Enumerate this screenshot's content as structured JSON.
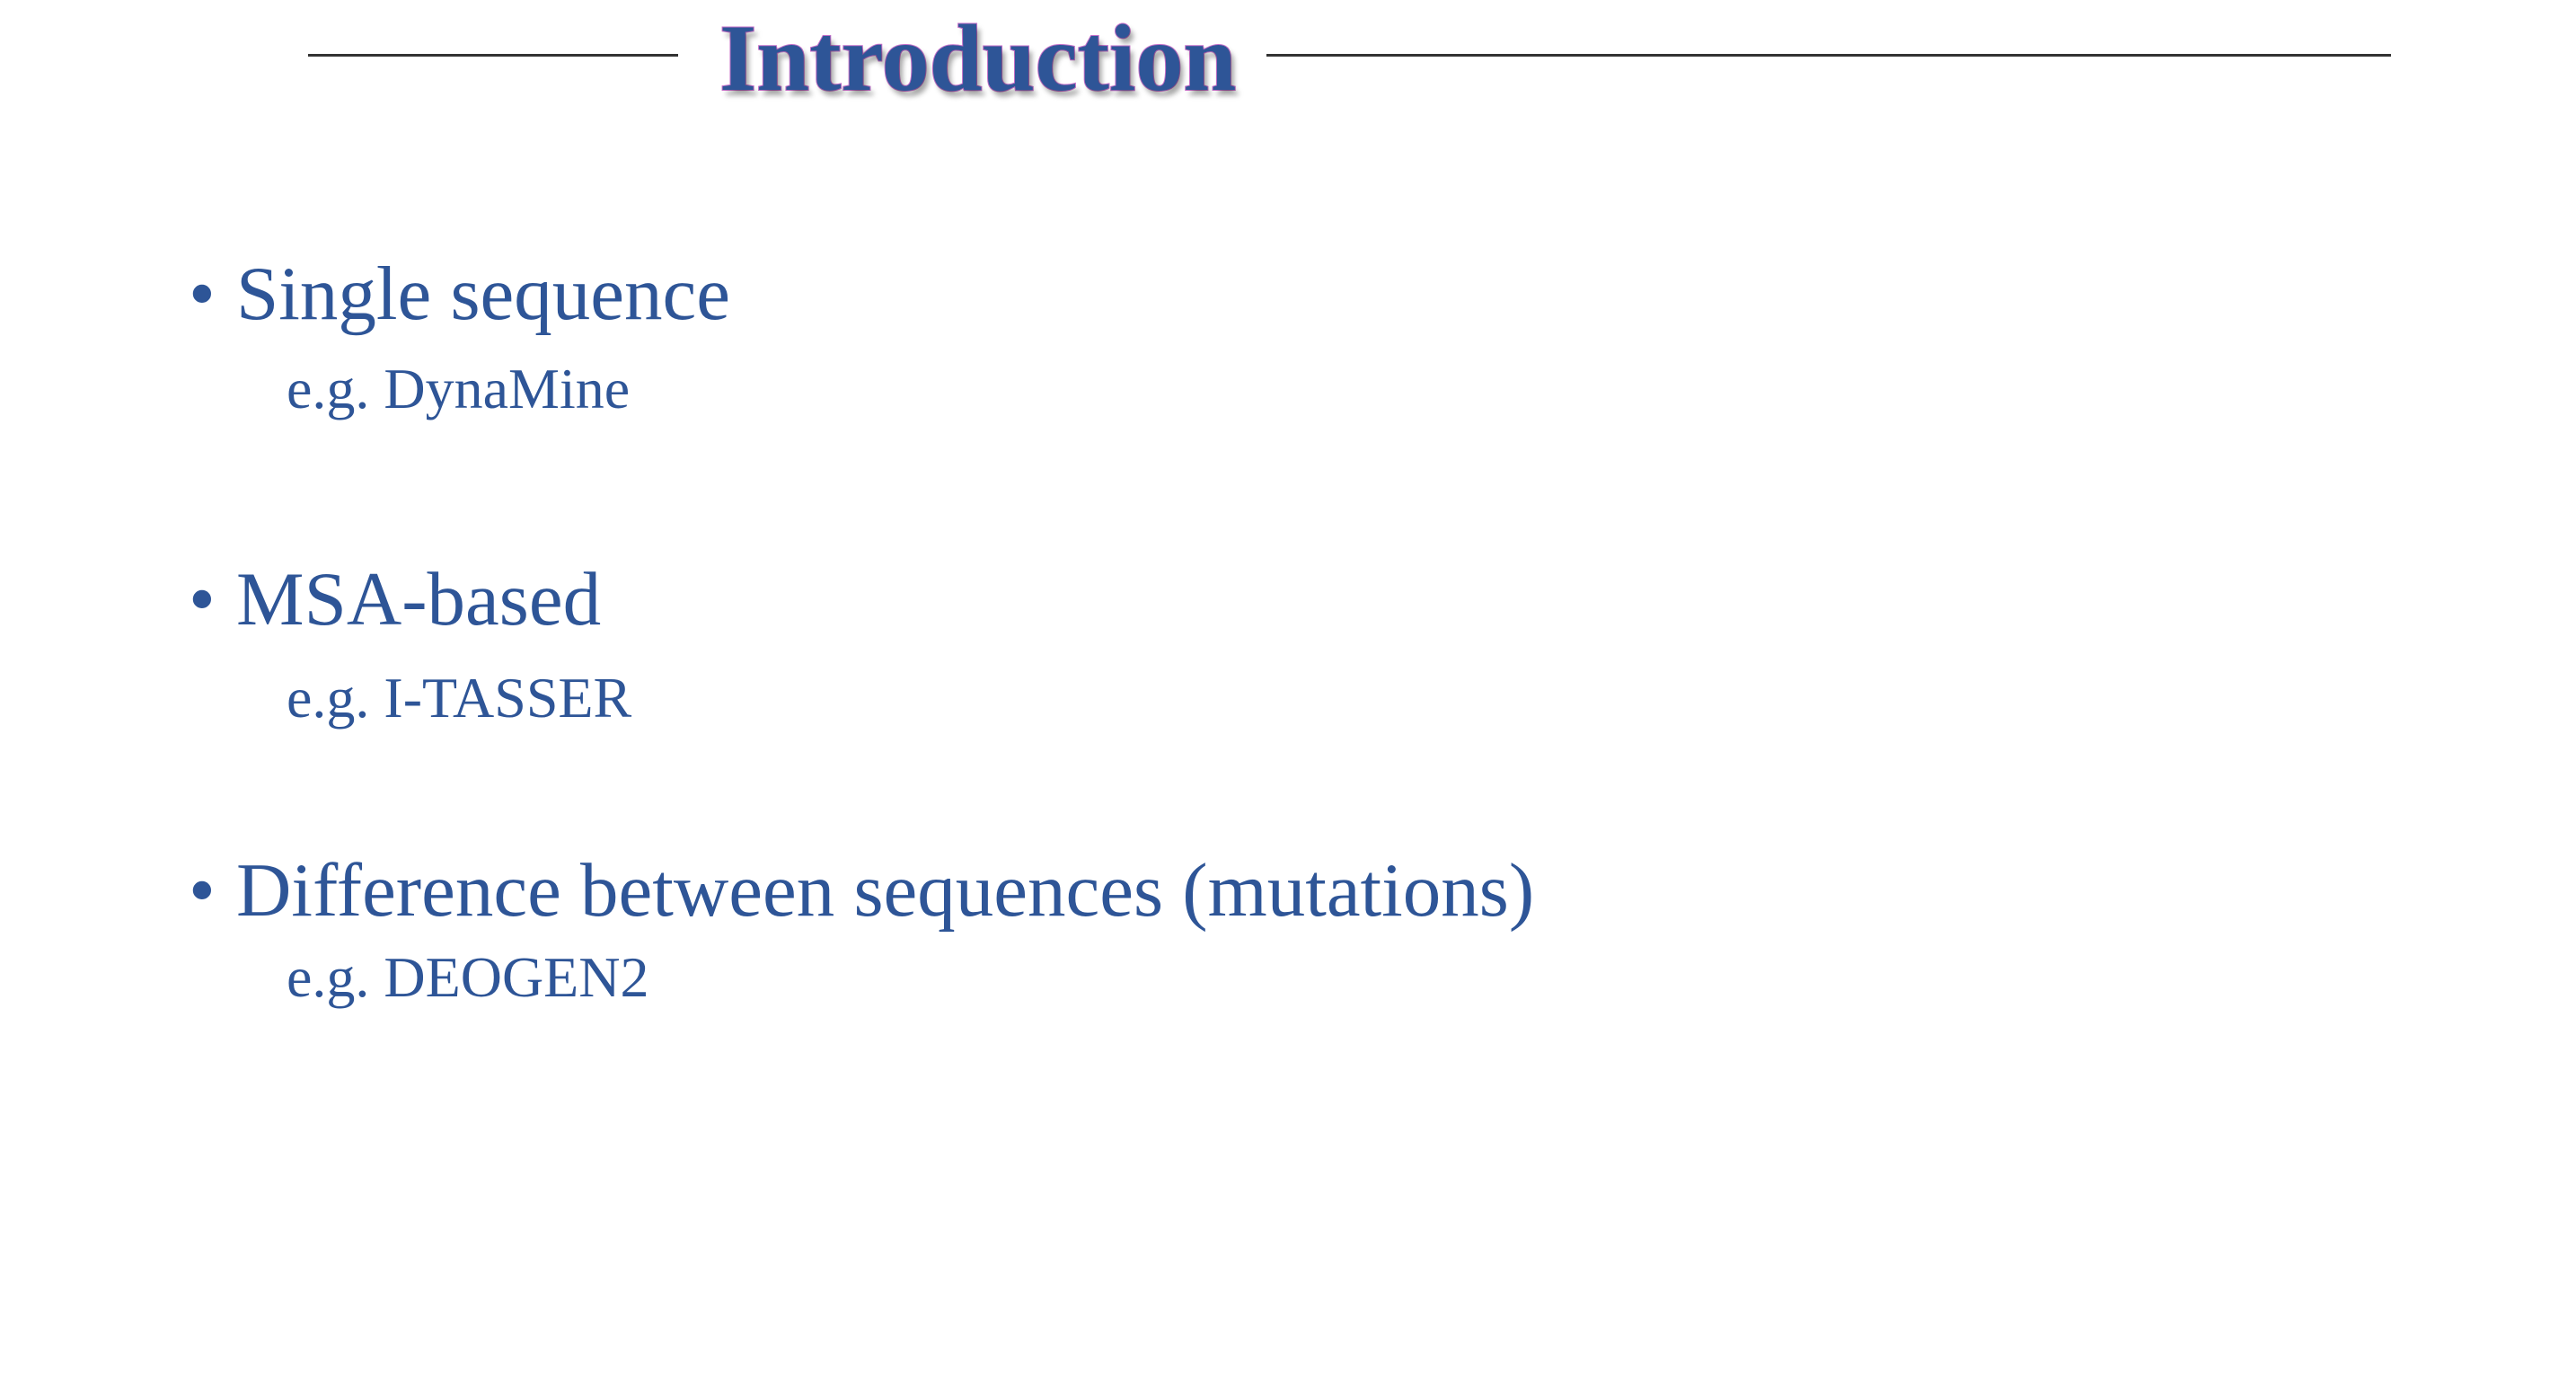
{
  "slide": {
    "title": "Introduction",
    "bullets": [
      {
        "label": "Single sequence",
        "example": "e.g. DynaMine"
      },
      {
        "label": "MSA-based",
        "example": "e.g. I-TASSER"
      },
      {
        "label": "Difference between sequences (mutations)",
        "example": "e.g. DEOGEN2"
      }
    ],
    "bullet_glyph": "•"
  },
  "colors": {
    "text": "#2E5597",
    "title_outline": "#C56FC9",
    "rule": "#333333"
  }
}
